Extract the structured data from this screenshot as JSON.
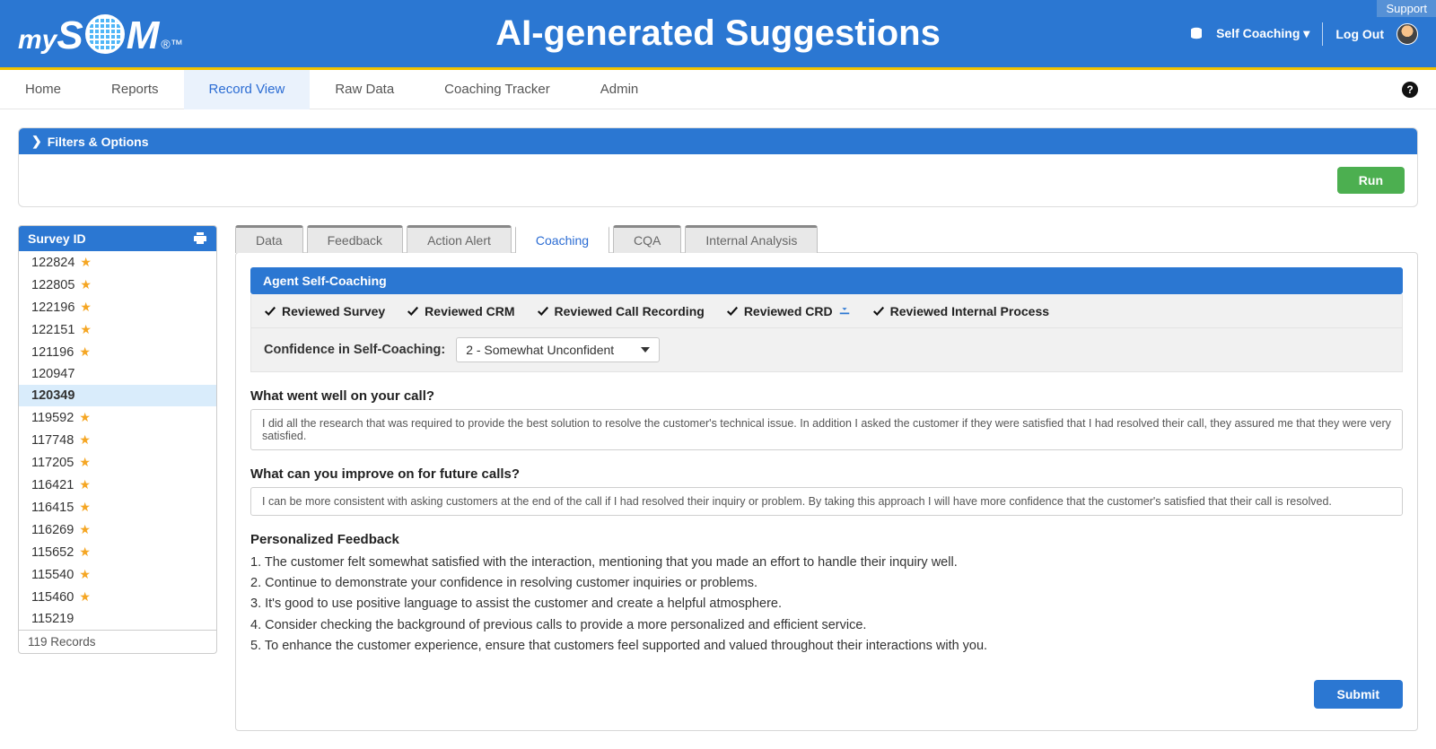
{
  "header": {
    "support": "Support",
    "page_title": "AI-generated Suggestions",
    "selector_label": "Self Coaching",
    "logout": "Log Out"
  },
  "nav": {
    "items": [
      "Home",
      "Reports",
      "Record View",
      "Raw Data",
      "Coaching Tracker",
      "Admin"
    ],
    "active_index": 2
  },
  "filters": {
    "title": "Filters & Options",
    "run": "Run"
  },
  "survey_panel": {
    "title": "Survey ID",
    "footer": "119 Records",
    "selected_id": "120349",
    "rows": [
      {
        "id": "122824",
        "star": true
      },
      {
        "id": "122805",
        "star": true
      },
      {
        "id": "122196",
        "star": true
      },
      {
        "id": "122151",
        "star": true
      },
      {
        "id": "121196",
        "star": true
      },
      {
        "id": "120947",
        "star": false
      },
      {
        "id": "120349",
        "star": false
      },
      {
        "id": "119592",
        "star": true
      },
      {
        "id": "117748",
        "star": true
      },
      {
        "id": "117205",
        "star": true
      },
      {
        "id": "116421",
        "star": true
      },
      {
        "id": "116415",
        "star": true
      },
      {
        "id": "116269",
        "star": true
      },
      {
        "id": "115652",
        "star": true
      },
      {
        "id": "115540",
        "star": true
      },
      {
        "id": "115460",
        "star": true
      },
      {
        "id": "115219",
        "star": false
      }
    ]
  },
  "tabs": {
    "items": [
      "Data",
      "Feedback",
      "Action Alert",
      "Coaching",
      "CQA",
      "Internal Analysis"
    ],
    "active_index": 3
  },
  "coaching": {
    "section_title": "Agent Self-Coaching",
    "checks": [
      {
        "label": "Reviewed Survey",
        "download": false
      },
      {
        "label": "Reviewed CRM",
        "download": false
      },
      {
        "label": "Reviewed Call Recording",
        "download": false
      },
      {
        "label": "Reviewed CRD",
        "download": true
      },
      {
        "label": "Reviewed Internal Process",
        "download": false
      }
    ],
    "confidence_label": "Confidence in Self-Coaching:",
    "confidence_value": "2 - Somewhat Unconfident",
    "q1": "What went well on your call?",
    "a1": "I did all the research that was required to provide the best solution to resolve the customer's technical issue. In addition I asked the customer if they were satisfied that I had resolved their call, they assured me that they were very satisfied.",
    "q2": "What can you improve on for future calls?",
    "a2": "I can be more consistent with asking customers at the end of the call if I had resolved their inquiry or problem. By taking this approach I will have more confidence that the customer's satisfied that their call is resolved.",
    "feedback_title": "Personalized Feedback",
    "feedback": [
      "1. The customer felt somewhat satisfied with the interaction, mentioning that you made an effort to handle their inquiry well.",
      "2. Continue to demonstrate your confidence in resolving customer inquiries or problems.",
      "3. It's good to use positive language to assist the customer and create a helpful atmosphere.",
      "4. Consider checking the background of previous calls to provide a more personalized and efficient service.",
      "5. To enhance the customer experience, ensure that customers feel supported and valued throughout their interactions with you."
    ],
    "submit": "Submit"
  }
}
